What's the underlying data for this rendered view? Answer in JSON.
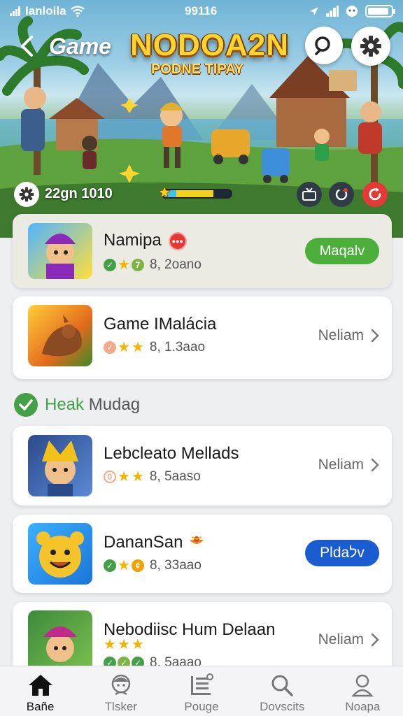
{
  "status_bar": {
    "carrier": "Ianloila",
    "time": "99116"
  },
  "hero": {
    "label": "Game",
    "title": "NODOA2N",
    "subtitle": "PODNE TIPAY",
    "score_text": "22gn 1010",
    "progress": {
      "cyan_fraction": 0.2,
      "yellow_fraction": 0.55
    }
  },
  "cards": [
    {
      "title": "Namipa",
      "badge_text": "●●●",
      "meta": "8, 2oano",
      "action": "Maqalv",
      "action_type": "button-green",
      "highlight": true
    },
    {
      "title": "Game IMalácia",
      "meta": "8, 1.3aao",
      "action": "Neliam",
      "action_type": "link"
    }
  ],
  "section": {
    "accent": "Heak",
    "rest": " Mudag"
  },
  "cards2": [
    {
      "title": "Lebcleato Mellads",
      "meta": "8, 5aaso",
      "action": "Neliam",
      "action_type": "link"
    },
    {
      "title": "DananSan",
      "meta": "8, 33aao",
      "action": "Pldaלv",
      "action_type": "button-blue"
    },
    {
      "title": "Nebodiisc Hum Delaan",
      "meta": "8, 5aaao",
      "action": "Neliam",
      "action_type": "link"
    }
  ],
  "nav": [
    {
      "label": "Bañe",
      "icon": "home-icon",
      "active": true
    },
    {
      "label": "Tlsker",
      "icon": "character-icon"
    },
    {
      "label": "Pouge",
      "icon": "list-icon"
    },
    {
      "label": "Dovscits",
      "icon": "search-icon"
    },
    {
      "label": "Noapa",
      "icon": "profile-icon"
    }
  ],
  "colors": {
    "green": "#4caf3c",
    "blue": "#1a5bd0",
    "red": "#e53935",
    "star": "#f4b400",
    "title_yellow": "#ffd52e"
  }
}
